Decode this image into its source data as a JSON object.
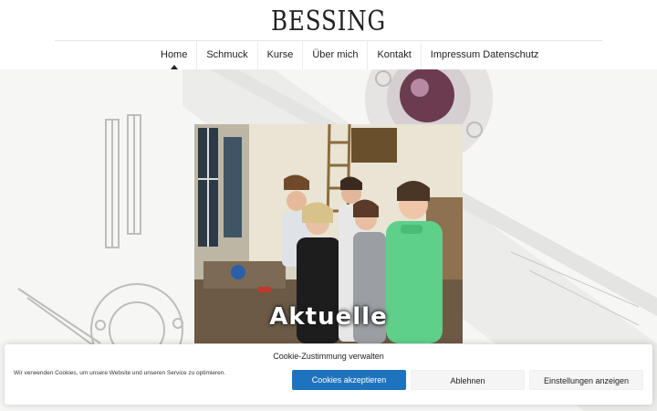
{
  "brand": {
    "logo_text": "BESSING"
  },
  "nav": {
    "items": [
      {
        "label": "Home",
        "active": true
      },
      {
        "label": "Schmuck",
        "active": false
      },
      {
        "label": "Kurse",
        "active": false
      },
      {
        "label": "Über mich",
        "active": false
      },
      {
        "label": "Kontakt",
        "active": false
      },
      {
        "label": "Impressum Datenschutz",
        "active": false
      }
    ]
  },
  "hero": {
    "caption": "Aktuelle"
  },
  "cookie": {
    "title": "Cookie-Zustimmung verwalten",
    "text": "Wir verwenden Cookies, um unsere Website und unseren Service zu optimieren.",
    "accept_label": "Cookies akzeptieren",
    "deny_label": "Ablehnen",
    "settings_label": "Einstellungen anzeigen"
  },
  "colors": {
    "accent": "#1e73be",
    "text": "#222222"
  }
}
